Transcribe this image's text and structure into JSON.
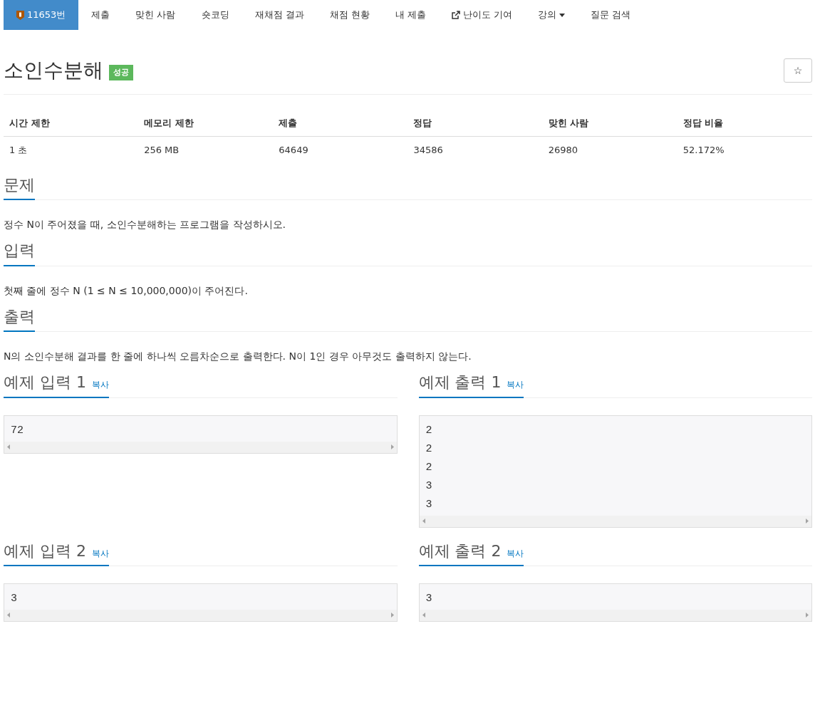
{
  "nav": [
    {
      "label": "11653번",
      "kind": "problem",
      "selected": true
    },
    {
      "label": "제출",
      "kind": "link",
      "selected": false
    },
    {
      "label": "맞힌 사람",
      "kind": "link",
      "selected": false
    },
    {
      "label": "숏코딩",
      "kind": "link",
      "selected": false
    },
    {
      "label": "재채점 결과",
      "kind": "link",
      "selected": false
    },
    {
      "label": "채점 현황",
      "kind": "link",
      "selected": false
    },
    {
      "label": "내 제출",
      "kind": "link",
      "selected": false
    },
    {
      "label": "난이도 기여",
      "kind": "external",
      "selected": false
    },
    {
      "label": "강의",
      "kind": "dropdown",
      "selected": false
    },
    {
      "label": "질문 검색",
      "kind": "link",
      "selected": false
    }
  ],
  "title": "소인수분해",
  "badge": "성공",
  "star": "☆",
  "stats": {
    "columns": [
      "시간 제한",
      "메모리 제한",
      "제출",
      "정답",
      "맞힌 사람",
      "정답 비율"
    ],
    "rows": [
      [
        "1 초",
        "256 MB",
        "64649",
        "34586",
        "26980",
        "52.172%"
      ]
    ]
  },
  "sections": [
    {
      "heading": "문제",
      "text": "정수 N이 주어졌을 때, 소인수분해하는 프로그램을 작성하시오."
    },
    {
      "heading": "입력",
      "text": "첫째 줄에 정수 N (1 ≤ N ≤ 10,000,000)이 주어진다."
    },
    {
      "heading": "출력",
      "text": "N의 소인수분해 결과를 한 줄에 하나씩 오름차순으로 출력한다. N이 1인 경우 아무것도 출력하지 않는다."
    }
  ],
  "samples": [
    [
      {
        "heading": "예제 입력 1",
        "copy": "복사",
        "lines": [
          "72"
        ]
      },
      {
        "heading": "예제 출력 1",
        "copy": "복사",
        "lines": [
          "2",
          "2",
          "2",
          "3",
          "3"
        ]
      }
    ],
    [
      {
        "heading": "예제 입력 2",
        "copy": "복사",
        "lines": [
          "3"
        ]
      },
      {
        "heading": "예제 출력 2",
        "copy": "복사",
        "lines": [
          "3"
        ]
      }
    ]
  ]
}
